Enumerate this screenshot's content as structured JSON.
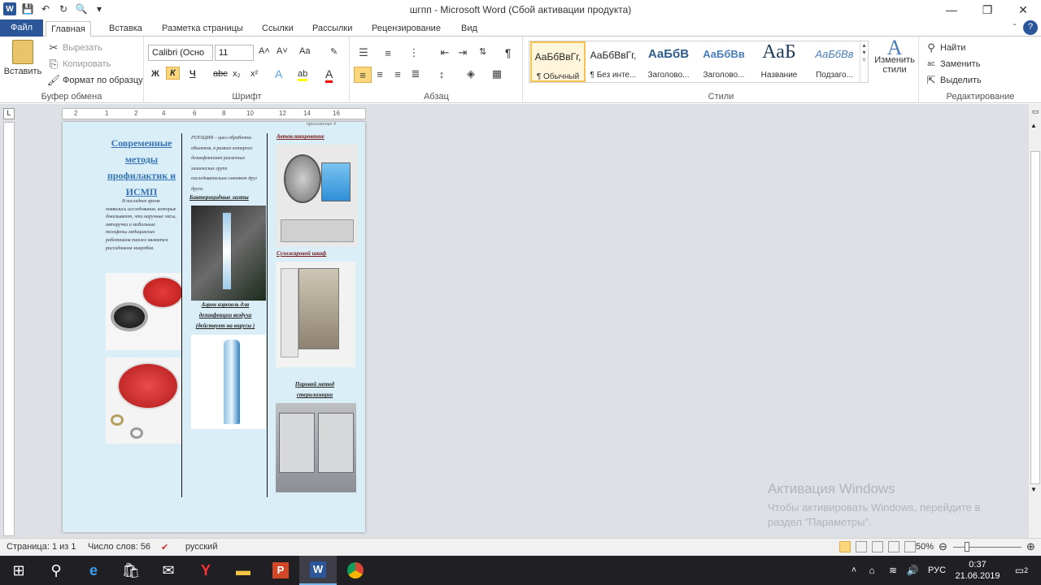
{
  "window": {
    "title": "шгпп - Microsoft Word (Сбой активации продукта)"
  },
  "qat": {
    "word": "W",
    "save": "💾",
    "undo": "↶",
    "redo": "↻",
    "preview": "🔍",
    "more": "▾"
  },
  "winctl": {
    "min": "—",
    "max": "❐",
    "close": "✕"
  },
  "tabs": [
    {
      "label": "Файл"
    },
    {
      "label": "Главная"
    },
    {
      "label": "Вставка"
    },
    {
      "label": "Разметка страницы"
    },
    {
      "label": "Ссылки"
    },
    {
      "label": "Рассылки"
    },
    {
      "label": "Рецензирование"
    },
    {
      "label": "Вид"
    }
  ],
  "help": "?",
  "collapse": "ˆ",
  "ribbon": {
    "clipboard": {
      "paste": "Вставить",
      "cut": "Вырезать",
      "copy": "Копировать",
      "format": "Формат по образцу",
      "label": "Буфер обмена"
    },
    "font": {
      "name": "Calibri (Осно",
      "size": "11",
      "label": "Шрифт",
      "bold": "Ж",
      "italic": "К",
      "underline": "Ч",
      "strike": "abc",
      "sub": "x₂",
      "sup": "x²",
      "grow": "A˄",
      "shrink": "A˅",
      "case": "Aa",
      "clear": "✎",
      "effects": "A",
      "highlight": "ab",
      "color": "A"
    },
    "paragraph": {
      "label": "Абзац",
      "pilcrow": "¶",
      "sort": "⇅"
    },
    "styles": {
      "label": "Стили",
      "change": "Изменить стили",
      "items": [
        {
          "preview": "АаБбВвГг,",
          "name": "¶ Обычный"
        },
        {
          "preview": "АаБбВвГг,",
          "name": "¶ Без инте..."
        },
        {
          "preview": "АаБбВ",
          "name": "Заголово..."
        },
        {
          "preview": "АаБбВв",
          "name": "Заголово..."
        },
        {
          "preview": "АаБ",
          "name": "Название"
        },
        {
          "preview": "АаБбВв",
          "name": "Подзаго..."
        }
      ]
    },
    "editing": {
      "label": "Редактирование",
      "find": "Найти",
      "replace": "Заменить",
      "select": "Выделить"
    }
  },
  "document": {
    "header_note": "приложение 4",
    "col1": {
      "title": "Современные методы профилактик и ИСМП",
      "body": "В последнее время появились исследования, которые доказывают, что наручные часы, авторучки и мобильные телефоны медицинских работников также являются рассадником микробов."
    },
    "col2": {
      "body": "РОТАЦИЯ – цикл обработки объектов, в рамках которого дезинфектант различных химических групп последовательно сменяют друг друга.",
      "cap1": "Бактерицидные лампы",
      "cap2": "Аэрон аэрозоль для дезинфекции воздуха (действует на вирусы )"
    },
    "col3": {
      "cap1": "Автоклавирование",
      "cap2": "Сухожаровой шкаф",
      "cap3": "Паровой метод стерилизации"
    }
  },
  "ruler": {
    "ticks": [
      "2",
      "1",
      "2",
      "4",
      "6",
      "8",
      "10",
      "12",
      "14",
      "16"
    ]
  },
  "statusbar": {
    "page": "Страница: 1 из 1",
    "words": "Число слов: 56",
    "lang": "русский",
    "zoom": "50%"
  },
  "watermark": {
    "title": "Активация Windows",
    "text": "Чтобы активировать Windows, перейдите в раздел \"Параметры\"."
  },
  "taskbar": {
    "lang": "РУС",
    "time": "0:37",
    "date": "21.06.2019",
    "notif": "2"
  }
}
